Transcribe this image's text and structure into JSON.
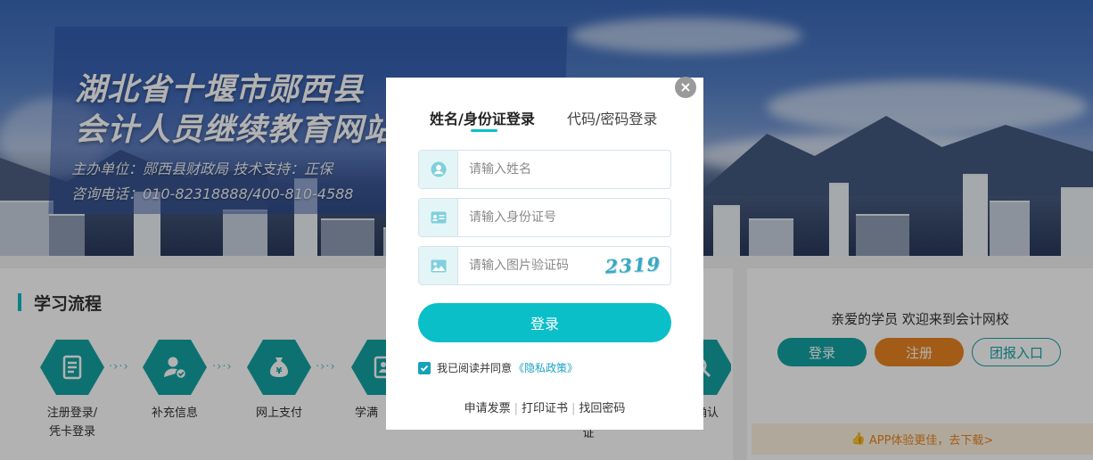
{
  "banner": {
    "title_line1": "湖北省十堰市郧西县",
    "title_line2": "会计人员继续教育网站",
    "sponsor": "主办单位：郧西县财政局    技术支持：正保",
    "hotline": "咨询电话：010-82318888/400-810-4588"
  },
  "process": {
    "section_title": "学习流程",
    "steps": [
      {
        "label": "注册登录/\n凭卡登录",
        "icon": "form-icon"
      },
      {
        "label": "补充信息",
        "icon": "user-check-icon"
      },
      {
        "label": "网上支付",
        "icon": "money-bag-icon"
      },
      {
        "label": "学满",
        "icon": "certificate-icon"
      }
    ],
    "hidden_step_fragment": "证",
    "right_step_fragment": "确认"
  },
  "sidebar": {
    "welcome": "亲爱的学员 欢迎来到会计网校",
    "login_label": "登录",
    "register_label": "注册",
    "group_label": "团报入口",
    "app_banner": "APP体验更佳，去下载>"
  },
  "modal": {
    "close_glyph": "×",
    "tabs": [
      {
        "label": "姓名/身份证登录",
        "active": true
      },
      {
        "label": "代码/密码登录",
        "active": false
      }
    ],
    "fields": {
      "name_placeholder": "请输入姓名",
      "id_placeholder": "请输入身份证号",
      "captcha_placeholder": "请输入图片验证码",
      "captcha_code": "2319"
    },
    "login_button": "登录",
    "agree_text": "我已阅读并同意",
    "policy_link": "《隐私政策》",
    "agree_checked": true,
    "footer_links": [
      "申请发票",
      "打印证书",
      "找回密码"
    ]
  },
  "colors": {
    "accent": "#0abfc8",
    "teal": "#14a3a3",
    "orange": "#e98422"
  }
}
